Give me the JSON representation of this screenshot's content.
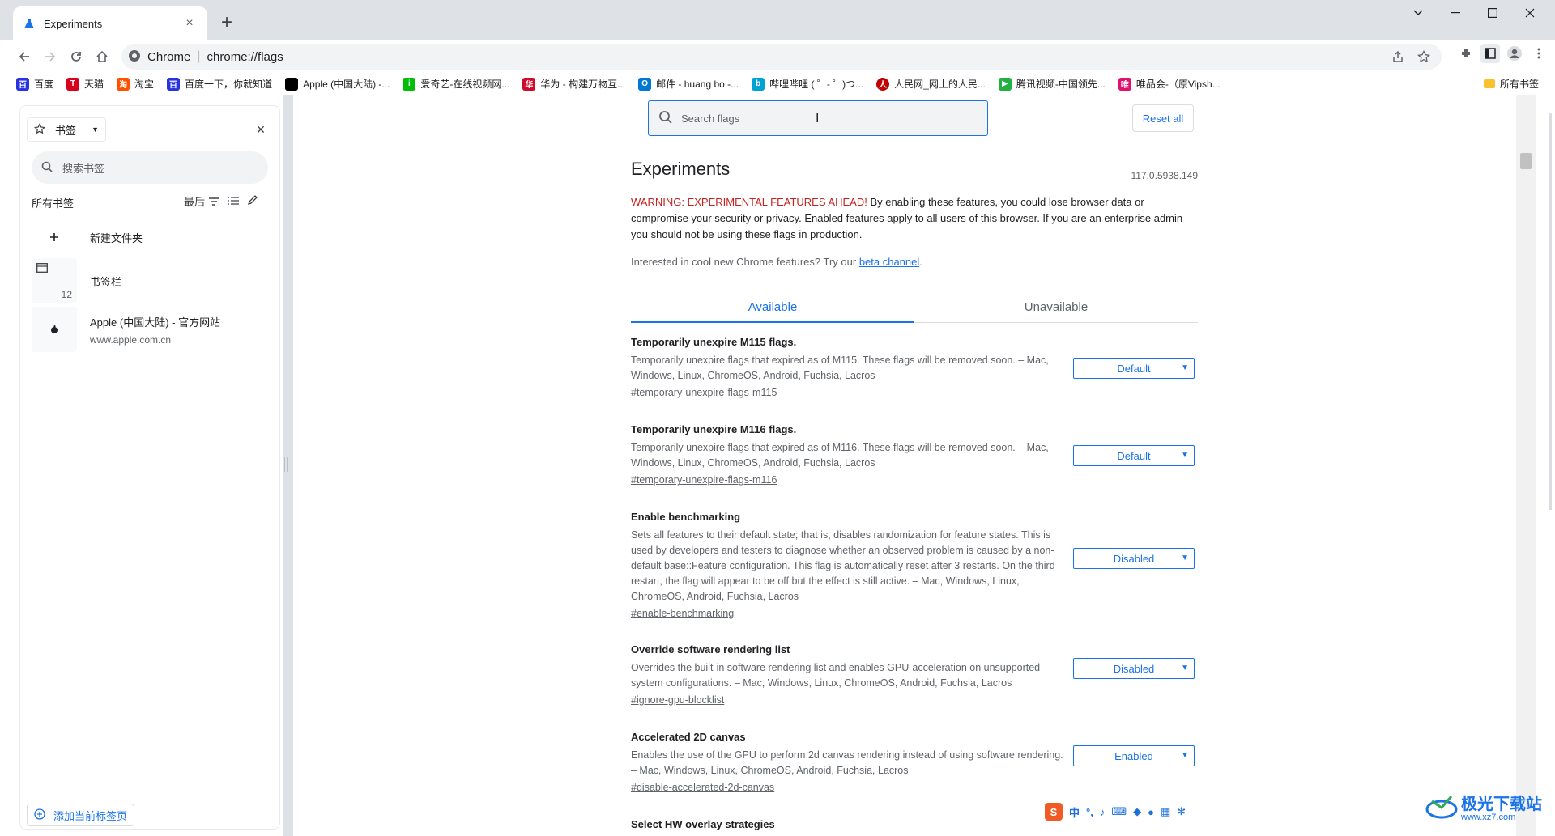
{
  "browser": {
    "tab_title": "Experiments",
    "omnibox_chrome": "Chrome",
    "omnibox_url": "chrome://flags"
  },
  "bookmarks_bar": {
    "items": [
      {
        "label": "百度",
        "color": "#2932e1"
      },
      {
        "label": "天猫",
        "color": "#d8001d"
      },
      {
        "label": "淘宝",
        "color": "#ff5000"
      },
      {
        "label": "百度一下，你就知道",
        "color": "#2932e1"
      },
      {
        "label": "Apple (中国大陆) -...",
        "color": "#000000"
      },
      {
        "label": "爱奇艺-在线视频网...",
        "color": "#00be06"
      },
      {
        "label": "华为 - 构建万物互...",
        "color": "#cf0a2c"
      },
      {
        "label": "邮件 - huang bo -...",
        "color": "#0078d4"
      },
      {
        "label": "哔哩哔哩 ( ゜- ゜)つ...",
        "color": "#00a1d6"
      },
      {
        "label": "人民网_网上的人民...",
        "color": "#c00000"
      },
      {
        "label": "腾讯视频-中国领先...",
        "color": "#20b142"
      },
      {
        "label": "唯品会-（原Vipsh...",
        "color": "#e0106e"
      }
    ],
    "all_bookmarks": "所有书签"
  },
  "side_panel": {
    "selector_label": "书签",
    "search_placeholder": "搜索书签",
    "section_title": "所有书签",
    "sort_label": "最后",
    "new_folder": "新建文件夹",
    "bookmarks_bar_label": "书签栏",
    "bookmarks_bar_count": "12",
    "apple_title": "Apple (中国大陆) - 官方网站",
    "apple_url": "www.apple.com.cn",
    "add_current": "添加当前标签页"
  },
  "flags_page": {
    "search_placeholder": "Search flags",
    "reset_all": "Reset all",
    "title": "Experiments",
    "version": "117.0.5938.149",
    "warning_red": "WARNING: EXPERIMENTAL FEATURES AHEAD!",
    "warning_text": " By enabling these features, you could lose browser data or compromise your security or privacy. Enabled features apply to all users of this browser. If you are an enterprise admin you should not be using these flags in production.",
    "interest_text": "Interested in cool new Chrome features? Try our ",
    "beta_link": "beta channel",
    "interest_end": ".",
    "tab_available": "Available",
    "tab_unavailable": "Unavailable",
    "flags": [
      {
        "name": "Temporarily unexpire M115 flags.",
        "desc": "Temporarily unexpire flags that expired as of M115. These flags will be removed soon. – Mac, Windows, Linux, ChromeOS, Android, Fuchsia, Lacros",
        "link": "#temporary-unexpire-flags-m115",
        "value": "Default"
      },
      {
        "name": "Temporarily unexpire M116 flags.",
        "desc": "Temporarily unexpire flags that expired as of M116. These flags will be removed soon. – Mac, Windows, Linux, ChromeOS, Android, Fuchsia, Lacros",
        "link": "#temporary-unexpire-flags-m116",
        "value": "Default"
      },
      {
        "name": "Enable benchmarking",
        "desc": "Sets all features to their default state; that is, disables randomization for feature states. This is used by developers and testers to diagnose whether an observed problem is caused by a non-default base::Feature configuration. This flag is automatically reset after 3 restarts. On the third restart, the flag will appear to be off but the effect is still active. – Mac, Windows, Linux, ChromeOS, Android, Fuchsia, Lacros",
        "link": "#enable-benchmarking",
        "value": "Disabled"
      },
      {
        "name": "Override software rendering list",
        "desc": "Overrides the built-in software rendering list and enables GPU-acceleration on unsupported system configurations. – Mac, Windows, Linux, ChromeOS, Android, Fuchsia, Lacros",
        "link": "#ignore-gpu-blocklist",
        "value": "Disabled"
      },
      {
        "name": "Accelerated 2D canvas",
        "desc": "Enables the use of the GPU to perform 2d canvas rendering instead of using software rendering. – Mac, Windows, Linux, ChromeOS, Android, Fuchsia, Lacros",
        "link": "#disable-accelerated-2d-canvas",
        "value": "Enabled"
      },
      {
        "name": "Select HW overlay strategies",
        "desc": "",
        "link": "",
        "value": ""
      }
    ]
  },
  "ime": {
    "lang": "中"
  },
  "watermark": {
    "text": "极光下载站",
    "url": "www.xz7.com"
  },
  "colors": {
    "accent": "#1a73e8",
    "warning": "#c5221f"
  }
}
